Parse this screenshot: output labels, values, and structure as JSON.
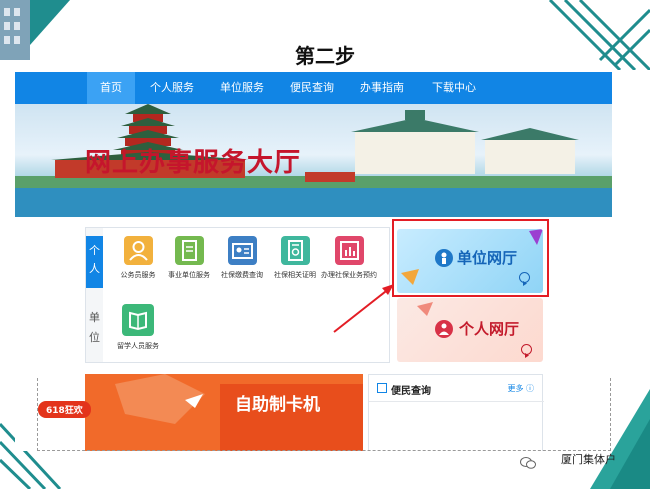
{
  "slide": {
    "title": "第二步"
  },
  "nav": {
    "items": [
      "首页",
      "个人服务",
      "单位服务",
      "便民查询",
      "办事指南",
      "下载中心"
    ],
    "active": "首页"
  },
  "banner": {
    "title": "网上办事服务大厅"
  },
  "panel": {
    "tabs": {
      "personal": "个人",
      "unit": "单位"
    },
    "services": [
      {
        "label": "公务员服务",
        "icon": "person-icon",
        "color": "#f2b13d"
      },
      {
        "label": "事业单位服务",
        "icon": "document-icon",
        "color": "#74b94f"
      },
      {
        "label": "社保缴费查询",
        "icon": "id-card-icon",
        "color": "#3d7fc4"
      },
      {
        "label": "社保相关证明",
        "icon": "certificate-icon",
        "color": "#3fb79d"
      },
      {
        "label": "办理社保业务预约",
        "icon": "chart-icon",
        "color": "#e0476a"
      },
      {
        "label": "留学人员服务",
        "icon": "book-icon",
        "color": "#3cb879"
      }
    ]
  },
  "cards": {
    "unit": "单位网厅",
    "personal": "个人网厅"
  },
  "promo": {
    "text": "自助制卡机",
    "badge": "618狂欢"
  },
  "convenience": {
    "title": "便民查询",
    "more": "更多"
  },
  "footer": {
    "text": "厦门集体户"
  }
}
